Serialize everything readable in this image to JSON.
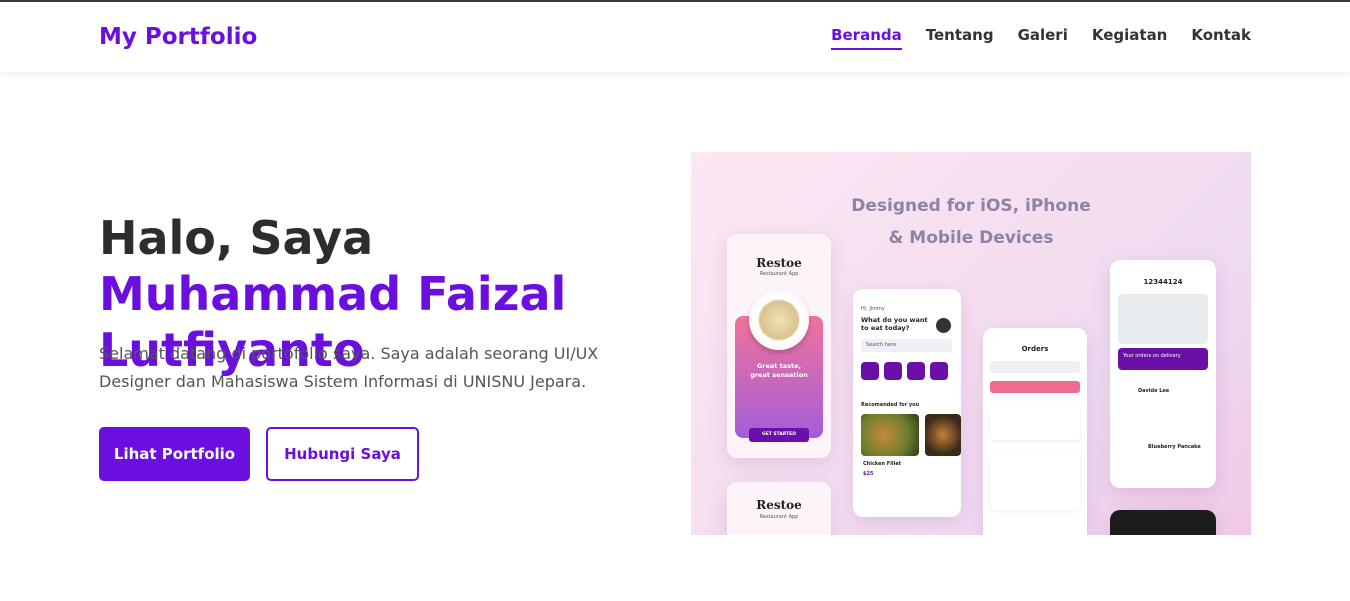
{
  "header": {
    "brand": "My Portfolio",
    "nav": [
      "Beranda",
      "Tentang",
      "Galeri",
      "Kegiatan",
      "Kontak"
    ]
  },
  "hero": {
    "title_plain": "Halo, Saya ",
    "title_highlight": "Muhammad Faizal Lutfiyanto",
    "description": "Selamat datang di portofolio saya. Saya adalah seorang UI/UX Designer dan Mahasiswa Sistem Informasi di UNISNU Jepara.",
    "primary_button": "Lihat Portfolio",
    "secondary_button": "Hubungi Saya"
  },
  "showcase": {
    "heading_line1": "Designed for iOS, iPhone",
    "heading_line2": "& Mobile Devices",
    "phone1_brand": "Restoe",
    "phone1_subtitle": "Restaurant App",
    "phone1_tagline": "Great taste, great sensation",
    "phone1_cta": "GET STARTED",
    "phone2_greeting": "Hi, Jimmy",
    "phone2_question": "What do you want to eat today?",
    "phone2_search": "Search here",
    "phone2_section": "Recomended for you",
    "phone2_item": "Chicken Fillet",
    "phone2_price": "$25",
    "phone3_title": "Orders",
    "phone4_order_id": "12344124",
    "phone4_delivery": "Your orders on delivery",
    "phone4_courier": "Davide Lee",
    "phone4_item": "Blueberry Pancake",
    "phone5_brand": "Restoe",
    "phone5_subtitle": "Restaurant App"
  },
  "colors": {
    "accent": "#6a0fe0",
    "text_dark": "#2d2d2d",
    "text_muted": "#555555",
    "showcase_heading": "#8c84a6"
  }
}
